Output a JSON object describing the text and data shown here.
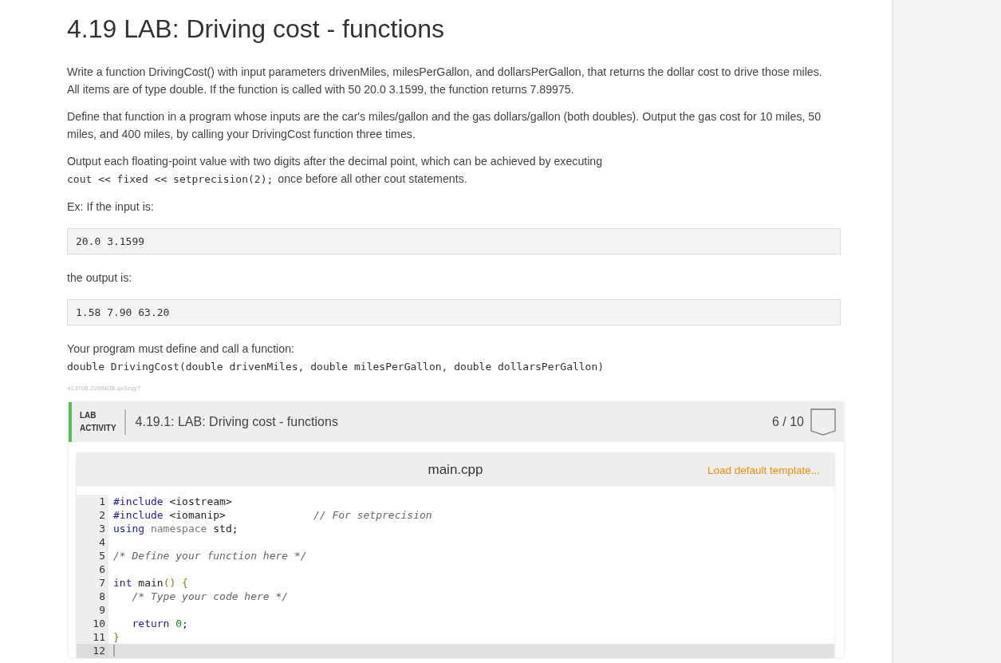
{
  "title": "4.19 LAB: Driving cost - functions",
  "paragraphs": [
    "Write a function DrivingCost() with input parameters drivenMiles, milesPerGallon, and dollarsPerGallon, that returns the dollar cost to drive those miles. All items are of type double. If the function is called with 50 20.0 3.1599, the function returns 7.89975.",
    "Define that function in a program whose inputs are the car's miles/gallon and the gas dollars/gallon (both doubles). Output the gas cost for 10 miles, 50 miles, and 400 miles, by calling your DrivingCost function three times."
  ],
  "precision_note": {
    "text": "Output each floating-point value with two digits after the decimal point, which can be achieved by executing",
    "code": "cout << fixed << setprecision(2);",
    "after": "once before all other cout statements."
  },
  "input_label": "Ex: If the input is:",
  "input_example": "20.0 3.1599",
  "output_label": "the output is:",
  "output_example": "1.58 7.90 63.20",
  "signature_label": "Your program must define and call a function:",
  "signature": "double DrivingCost(double drivenMiles, double milesPerGallon, double dollarsPerGallon)",
  "activity_id": "413706.2298628.qx3zqy7",
  "lab": {
    "tag_line1": "LAB",
    "tag_line2": "ACTIVITY",
    "title": "4.19.1: LAB: Driving cost - functions",
    "score": "6 / 10"
  },
  "editor": {
    "filename": "main.cpp",
    "template_link": "Load default template...",
    "lines": [
      {
        "number": "1",
        "current": false,
        "tokens": [
          {
            "text": "#include",
            "kind": "keyword"
          },
          {
            "text": " <iostream>",
            "kind": "plain"
          }
        ]
      },
      {
        "number": "2",
        "current": false,
        "tokens": [
          {
            "text": "#include",
            "kind": "keyword"
          },
          {
            "text": " <iomanip>",
            "kind": "plain"
          },
          {
            "text": "// For setprecision",
            "kind": "side-comment"
          }
        ]
      },
      {
        "number": "3",
        "current": false,
        "tokens": [
          {
            "text": "using",
            "kind": "keyword"
          },
          {
            "text": " namespace",
            "kind": "dim"
          },
          {
            "text": " std;",
            "kind": "plain"
          }
        ]
      },
      {
        "number": "4",
        "current": false
      },
      {
        "number": "5",
        "current": false,
        "tokens": [
          {
            "text": "/* Define your function here */",
            "kind": "comment"
          }
        ]
      },
      {
        "number": "6",
        "current": false
      },
      {
        "number": "7",
        "current": false,
        "tokens": [
          {
            "text": "int",
            "kind": "keyword"
          },
          {
            "text": " main",
            "kind": "plain"
          },
          {
            "text": "() {",
            "kind": "bracket"
          }
        ]
      },
      {
        "number": "8",
        "current": false,
        "tokens": [
          {
            "text": "   /* Type your code here */",
            "kind": "comment"
          }
        ]
      },
      {
        "number": "9",
        "current": false
      },
      {
        "number": "10",
        "current": false,
        "tokens": [
          {
            "text": "   return",
            "kind": "keyword"
          },
          {
            "text": " 0",
            "kind": "number"
          },
          {
            "text": ";",
            "kind": "plain"
          }
        ]
      },
      {
        "number": "11",
        "current": false,
        "tokens": [
          {
            "text": "}",
            "kind": "bracket"
          }
        ]
      },
      {
        "number": "12",
        "current": true
      }
    ]
  }
}
